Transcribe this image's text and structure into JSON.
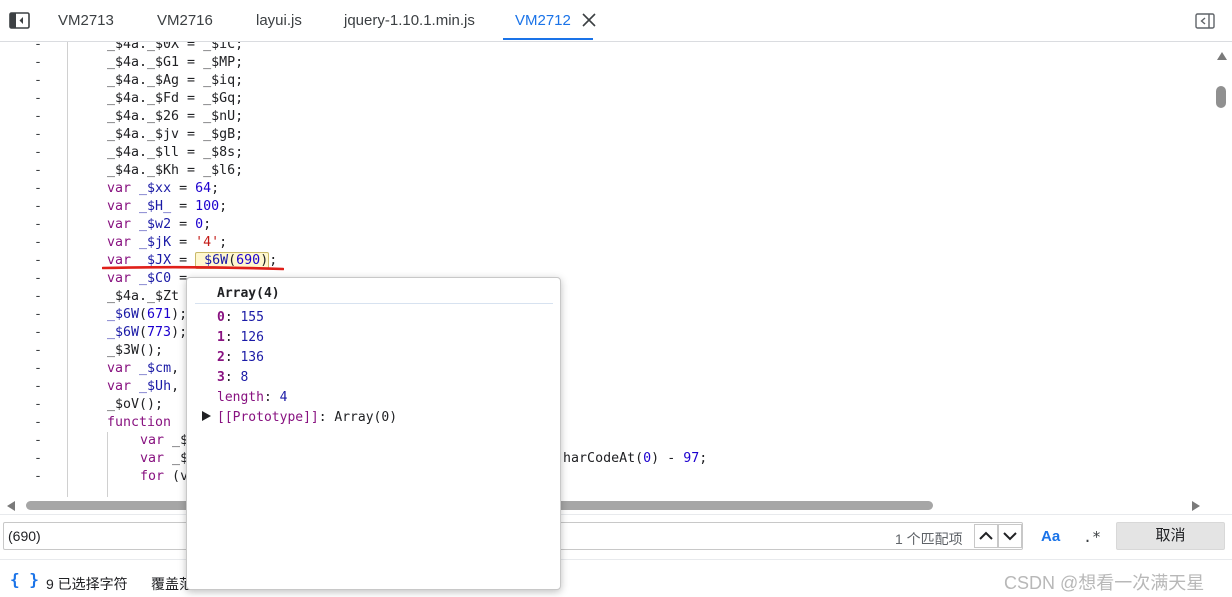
{
  "tabs": [
    {
      "label": "VM2713",
      "active": false
    },
    {
      "label": "VM2716",
      "active": false
    },
    {
      "label": "layui.js",
      "active": false
    },
    {
      "label": "jquery-1.10.1.min.js",
      "active": false
    },
    {
      "label": "VM2712",
      "active": true
    }
  ],
  "icons": {
    "sidebar_toggle": "sidebar-toggle-icon",
    "close": "close-icon",
    "collapse_panel": "collapse-right-panel-icon",
    "scroll_up": "triangle-up-icon",
    "scroll_left": "triangle-left-icon",
    "scroll_right": "triangle-right-icon",
    "prev_match": "chevron-up-icon",
    "next_match": "chevron-down-icon",
    "expand": "triangle-right-icon"
  },
  "editor": {
    "gutter_marker": "-",
    "lines": [
      "_$4a._$0X = _$iC;",
      "_$4a._$G1 = _$MP;",
      "_$4a._$Ag = _$iq;",
      "_$4a._$Fd = _$Gq;",
      "_$4a._$26 = _$nU;",
      "_$4a._$jv = _$gB;",
      "_$4a._$ll = _$8s;",
      "_$4a._$Kh = _$l6;",
      "var _$xx = 64;",
      "var _$H_ = 100;",
      "var _$w2 = 0;",
      "var _$jK = '4';",
      "var _$JX = _$6W(690);",
      "var _$C0 = ",
      "_$4a._$Zt",
      "_$6W(671);",
      "_$6W(773);",
      "_$3W();",
      "var _$cm,",
      "var _$Uh,",
      "_$oV();",
      "function ",
      "var _$",
      "var _$",
      "for (v"
    ],
    "line_tail": "harCodeAt(0) - 97;"
  },
  "search": {
    "query": "(690)",
    "match_count": "1 个匹配项",
    "case_label": "Aa",
    "regex_label": ".*",
    "cancel_label": "取消"
  },
  "status": {
    "pretty_print": "{ }",
    "selected": "9 已选择字符",
    "coverage": "覆盖范"
  },
  "watermark": "CSDN @想看一次满天星",
  "popover": {
    "title": "Array(4)",
    "items": [
      {
        "key": "0",
        "value": "155"
      },
      {
        "key": "1",
        "value": "126"
      },
      {
        "key": "2",
        "value": "136"
      },
      {
        "key": "3",
        "value": "8"
      }
    ],
    "length_key": "length",
    "length_value": "4",
    "proto_key": "[[Prototype]]",
    "proto_value": "Array(0)"
  },
  "colors": {
    "accent": "#1a73e8",
    "keyword": "#881280",
    "number": "#1c00cf",
    "string": "#c41a16",
    "underline": "#e0201a",
    "highlight": "#fff7cf"
  }
}
